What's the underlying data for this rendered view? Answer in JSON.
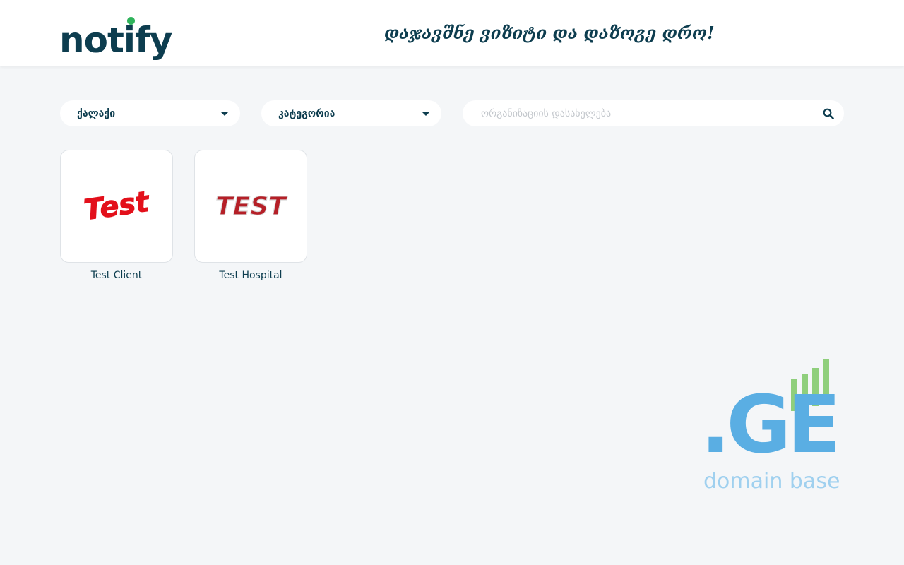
{
  "header": {
    "logo_text": "notify",
    "tagline": "დაჯავშნე ვიზიტი და დაზოგე დრო!"
  },
  "filters": {
    "city_label": "ქალაქი",
    "category_label": "კატეგორია",
    "search_placeholder": "ორგანიზაციის დასახელება",
    "search_value": ""
  },
  "organizations": [
    {
      "name": "Test Client",
      "logo_text": "Test"
    },
    {
      "name": "Test Hospital",
      "logo_text": "TEST"
    }
  ],
  "watermark": {
    "mark": ".GE",
    "caption": "domain base"
  },
  "colors": {
    "brand": "#0d3d4f",
    "brand_dot": "#2fb35b",
    "test_red": "#e3101b",
    "hospital_red": "#b51f27",
    "ge_blue": "#5aaee3",
    "ge_green": "#8fcf7c",
    "background": "#f4f6f8"
  }
}
